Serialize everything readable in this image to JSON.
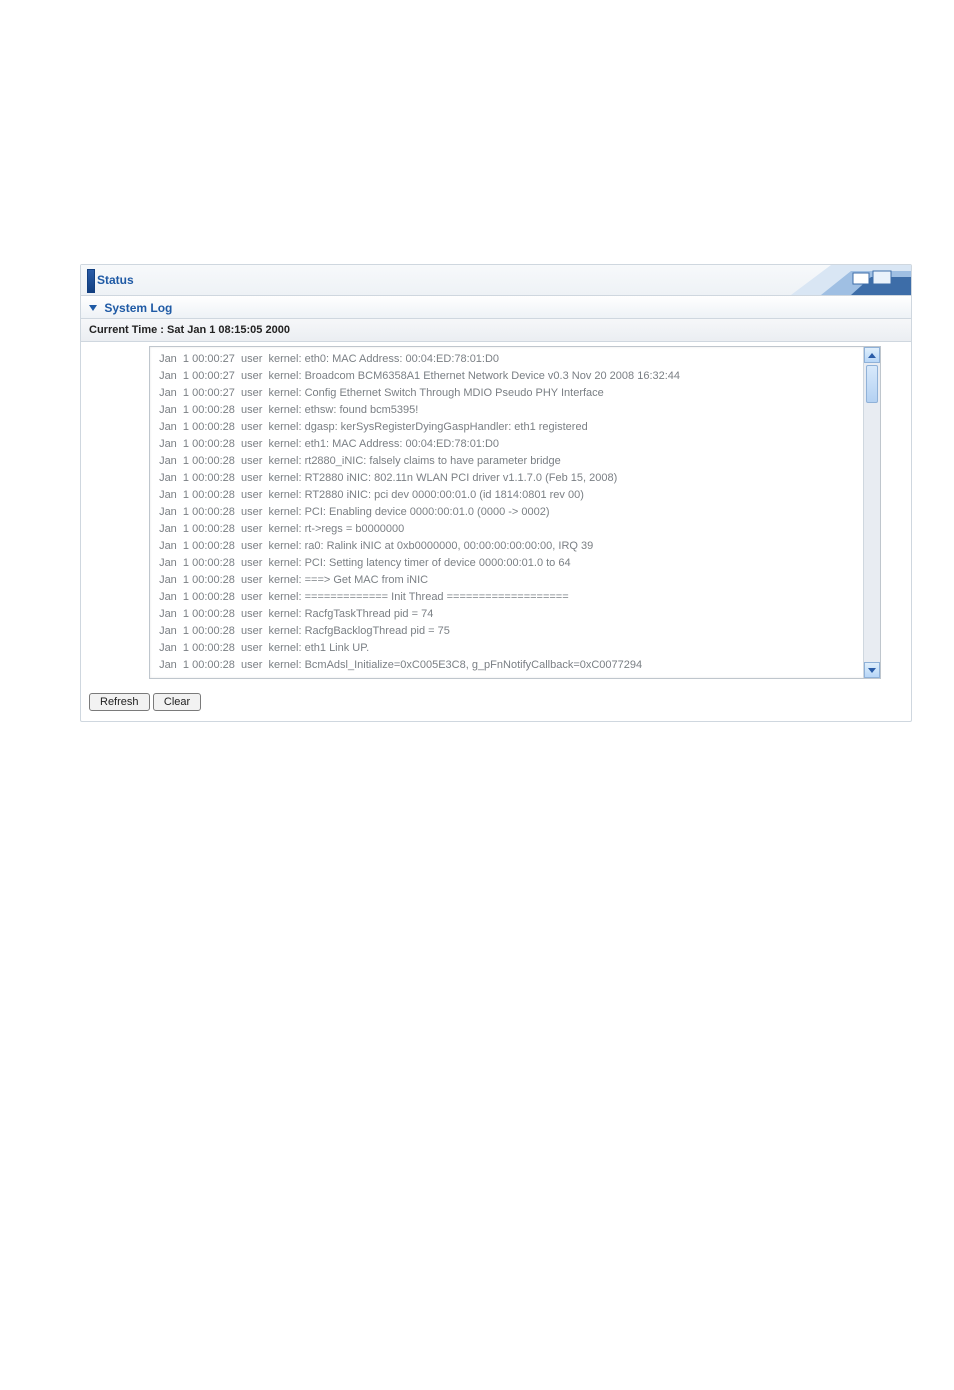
{
  "header": {
    "tab_label": "Status"
  },
  "section": {
    "title": "System Log"
  },
  "time_row": {
    "label": "Current Time : Sat Jan 1 08:15:05 2000"
  },
  "log": {
    "lines": [
      " Jan  1 00:00:27  user  kernel: eth0: MAC Address: 00:04:ED:78:01:D0",
      " Jan  1 00:00:27  user  kernel: Broadcom BCM6358A1 Ethernet Network Device v0.3 Nov 20 2008 16:32:44",
      " Jan  1 00:00:27  user  kernel: Config Ethernet Switch Through MDIO Pseudo PHY Interface",
      " Jan  1 00:00:28  user  kernel: ethsw: found bcm5395!",
      " Jan  1 00:00:28  user  kernel: dgasp: kerSysRegisterDyingGaspHandler: eth1 registered",
      " Jan  1 00:00:28  user  kernel: eth1: MAC Address: 00:04:ED:78:01:D0",
      " Jan  1 00:00:28  user  kernel: rt2880_iNIC: falsely claims to have parameter bridge",
      " Jan  1 00:00:28  user  kernel: RT2880 iNIC: 802.11n WLAN PCI driver v1.1.7.0 (Feb 15, 2008)",
      " Jan  1 00:00:28  user  kernel: RT2880 iNIC: pci dev 0000:00:01.0 (id 1814:0801 rev 00)",
      " Jan  1 00:00:28  user  kernel: PCI: Enabling device 0000:00:01.0 (0000 -> 0002)",
      " Jan  1 00:00:28  user  kernel: rt->regs = b0000000",
      " Jan  1 00:00:28  user  kernel: ra0: Ralink iNIC at 0xb0000000, 00:00:00:00:00:00, IRQ 39",
      " Jan  1 00:00:28  user  kernel: PCI: Setting latency timer of device 0000:00:01.0 to 64",
      " Jan  1 00:00:28  user  kernel: ===> Get MAC from iNIC",
      " Jan  1 00:00:28  user  kernel: ============= Init Thread ===================",
      " Jan  1 00:00:28  user  kernel: RacfgTaskThread pid = 74",
      " Jan  1 00:00:28  user  kernel: RacfgBacklogThread pid = 75",
      " Jan  1 00:00:28  user  kernel: eth1 Link UP.",
      " Jan  1 00:00:28  user  kernel: BcmAdsl_Initialize=0xC005E3C8, g_pFnNotifyCallback=0xC0077294"
    ]
  },
  "buttons": {
    "refresh": "Refresh",
    "clear": "Clear"
  }
}
